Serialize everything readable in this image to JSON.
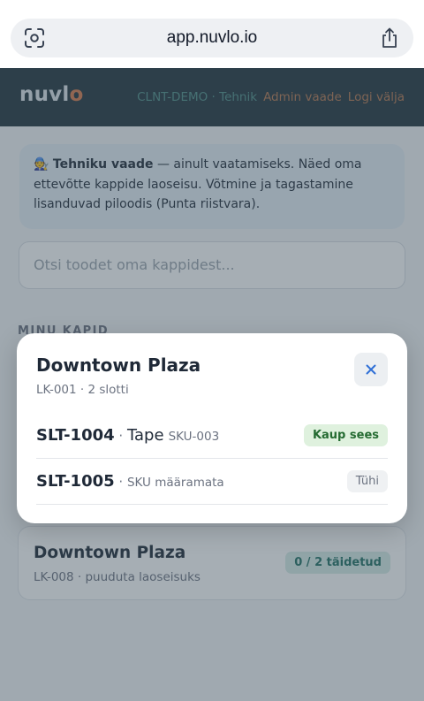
{
  "browser": {
    "url": "app.nuvlo.io"
  },
  "header": {
    "logo_main": "nuvl",
    "logo_accent": "o",
    "context": "CLNT-DEMO · Tehnik",
    "admin_link": "Admin vaade",
    "logout_link": "Logi välja"
  },
  "info": {
    "icon": "🧑‍🔧",
    "title": "Tehniku vaade",
    "text": " — ainult vaatamiseks. Näed oma ettevõtte kappide laoseisu. Võtmine ja tagastamine lisanduvad piloodis (Punta riistvara)."
  },
  "search": {
    "placeholder": "Otsi toodet oma kappidest..."
  },
  "section": {
    "title": "MINU KAPID"
  },
  "background_card": {
    "title": "Downtown Plaza",
    "subtitle": "LK-008 · puuduta laoseisuks",
    "badge": "0 / 2 täidetud"
  },
  "modal": {
    "title": "Downtown Plaza",
    "subtitle": "LK-001 · 2 slotti",
    "slots": [
      {
        "id": "SLT-1004",
        "sep": " · ",
        "name": "Tape",
        "sku": "SKU-003",
        "status": "Kaup sees"
      },
      {
        "id": "SLT-1005",
        "sep": " · ",
        "name": "",
        "sku": "SKU määramata",
        "status": "Tühi"
      }
    ]
  },
  "colors": {
    "header_bg": "#21333c",
    "accent": "#d97a4a",
    "context_text": "#4f8e88",
    "badge_green_bg": "#dff1de",
    "badge_green_text": "#256b32"
  }
}
